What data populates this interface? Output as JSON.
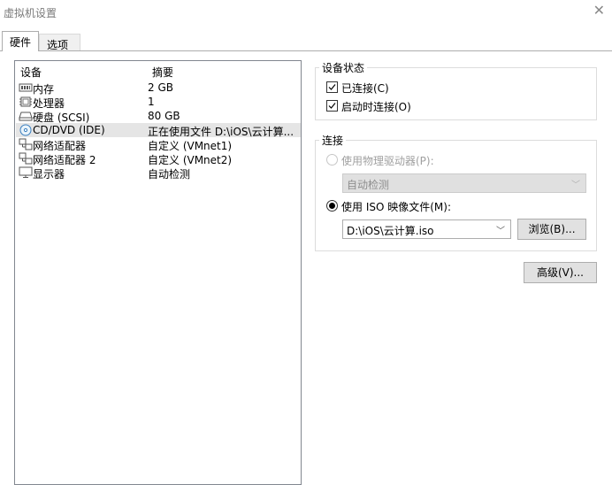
{
  "window": {
    "title": "虚拟机设置"
  },
  "tabs": [
    {
      "label": "硬件",
      "active": true
    },
    {
      "label": "选项",
      "active": false
    }
  ],
  "device_list": {
    "headers": {
      "device": "设备",
      "summary": "摘要"
    },
    "rows": [
      {
        "name": "内存",
        "summary": "2 GB",
        "icon": "memory-icon",
        "selected": false
      },
      {
        "name": "处理器",
        "summary": "1",
        "icon": "processor-icon",
        "selected": false
      },
      {
        "name": "硬盘 (SCSI)",
        "summary": "80 GB",
        "icon": "hard-disk-icon",
        "selected": false
      },
      {
        "name": "CD/DVD (IDE)",
        "summary": "正在使用文件 D:\\iOS\\云计算...",
        "icon": "cd-dvd-icon",
        "selected": true
      },
      {
        "name": "网络适配器",
        "summary": "自定义 (VMnet1)",
        "icon": "network-adapter-icon",
        "selected": false
      },
      {
        "name": "网络适配器 2",
        "summary": "自定义 (VMnet2)",
        "icon": "network-adapter-icon",
        "selected": false
      },
      {
        "name": "显示器",
        "summary": "自动检测",
        "icon": "display-icon",
        "selected": false
      }
    ]
  },
  "device_status": {
    "title": "设备状态",
    "connected": {
      "label": "已连接(C)",
      "checked": true
    },
    "connect_at_power_on": {
      "label": "启动时连接(O)",
      "checked": true
    }
  },
  "connection": {
    "title": "连接",
    "physical_drive": {
      "label": "使用物理驱动器(P):",
      "selected": false,
      "enabled": false
    },
    "physical_drive_select": {
      "value": "自动检测"
    },
    "iso_image": {
      "label": "使用 ISO 映像文件(M):",
      "selected": true
    },
    "iso_path": {
      "value": "D:\\iOS\\云计算.iso"
    },
    "browse_label": "浏览(B)..."
  },
  "advanced_label": "高级(V)..."
}
